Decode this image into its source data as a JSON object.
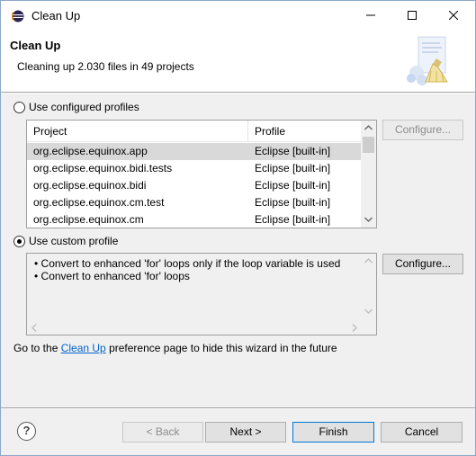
{
  "window": {
    "title": "Clean Up",
    "minimize_glyph": "—",
    "close_glyph": "✕"
  },
  "header": {
    "title": "Clean Up",
    "description": "Cleaning up 2.030 files in 49 projects"
  },
  "configured": {
    "radio_label": "Use configured profiles",
    "selected": false,
    "columns": [
      "Project",
      "Profile"
    ],
    "rows": [
      {
        "project": "org.eclipse.equinox.app",
        "profile": "Eclipse [built-in]"
      },
      {
        "project": "org.eclipse.equinox.bidi.tests",
        "profile": "Eclipse [built-in]"
      },
      {
        "project": "org.eclipse.equinox.bidi",
        "profile": "Eclipse [built-in]"
      },
      {
        "project": "org.eclipse.equinox.cm.test",
        "profile": "Eclipse [built-in]"
      },
      {
        "project": "org.eclipse.equinox.cm",
        "profile": "Eclipse [built-in]"
      }
    ],
    "configure_label": "Configure..."
  },
  "custom": {
    "radio_label": "Use custom profile",
    "selected": true,
    "items": [
      "•  Convert to enhanced 'for' loops only if the loop variable is used",
      "•  Convert to enhanced 'for' loops"
    ],
    "configure_label": "Configure..."
  },
  "hint": {
    "before": "Go to the ",
    "link": "Clean Up",
    "after": " preference page to hide this wizard in the future"
  },
  "footer": {
    "help_glyph": "?",
    "back_label": "< Back",
    "next_label": "Next >",
    "finish_label": "Finish",
    "cancel_label": "Cancel"
  },
  "icons": {
    "app": "eclipse-icon",
    "banner": "cleanup-wizard-icon"
  }
}
